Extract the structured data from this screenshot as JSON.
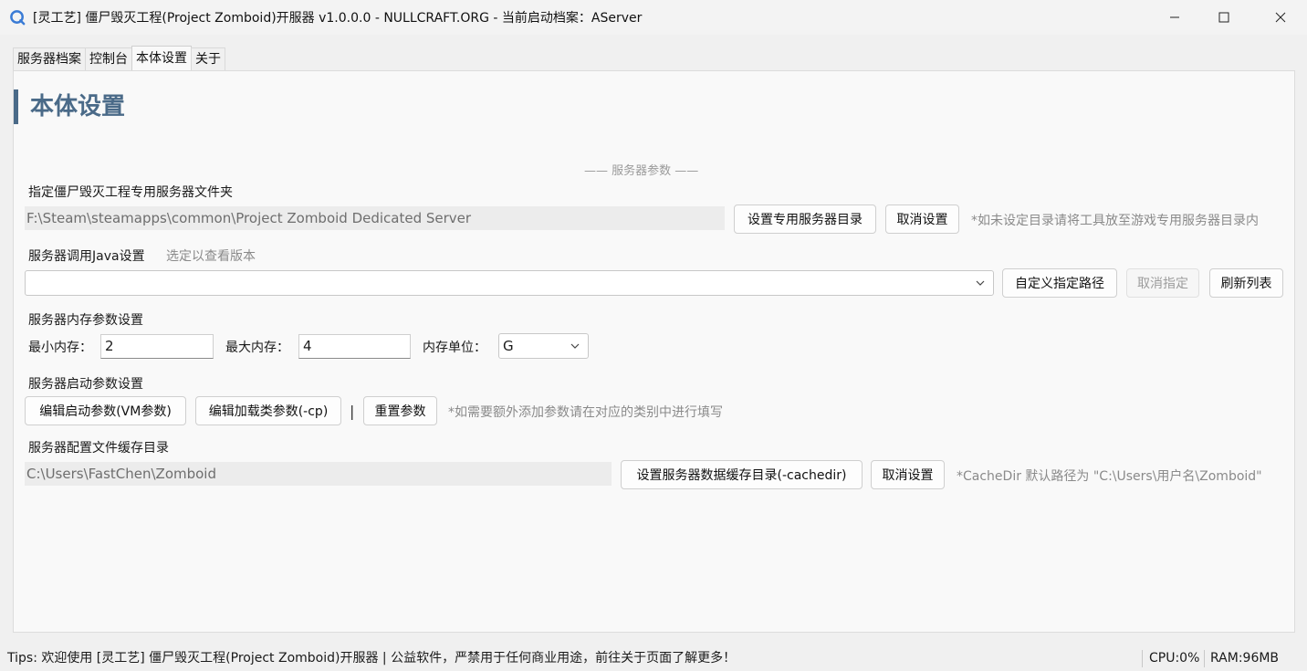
{
  "window": {
    "title": "[灵工艺] 僵尸毁灭工程(Project Zomboid)开服器 v1.0.0.0 - NULLCRAFT.ORG - 当前启动档案：AServer"
  },
  "tabs": [
    {
      "label": "服务器档案",
      "active": false
    },
    {
      "label": "控制台",
      "active": false
    },
    {
      "label": "本体设置",
      "active": true
    },
    {
      "label": "关于",
      "active": false
    }
  ],
  "page": {
    "title": "本体设置",
    "section_header": "—— 服务器参数 ——"
  },
  "server_dir": {
    "label": "指定僵尸毁灭工程专用服务器文件夹",
    "value": "F:\\Steam\\steamapps\\common\\Project Zomboid Dedicated Server",
    "set_button": "设置专用服务器目录",
    "cancel_button": "取消设置",
    "hint": "*如未设定目录请将工具放至游戏专用服务器目录内"
  },
  "java": {
    "label": "服务器调用Java设置",
    "hint": "选定以查看版本",
    "selected": "",
    "custom_button": "自定义指定路径",
    "cancel_button": "取消指定",
    "refresh_button": "刷新列表"
  },
  "memory": {
    "label": "服务器内存参数设置",
    "min_label": "最小内存：",
    "min_value": "2",
    "max_label": "最大内存：",
    "max_value": "4",
    "unit_label": "内存单位：",
    "unit_value": "G"
  },
  "launch": {
    "label": "服务器启动参数设置",
    "vm_button": "编辑启动参数(VM参数)",
    "cp_button": "编辑加载类参数(-cp)",
    "separator": "|",
    "reset_button": "重置参数",
    "hint": "*如需要额外添加参数请在对应的类别中进行填写"
  },
  "cache": {
    "label": "服务器配置文件缓存目录",
    "value": "C:\\Users\\FastChen\\Zomboid",
    "set_button": "设置服务器数据缓存目录(-cachedir)",
    "cancel_button": "取消设置",
    "hint": "*CacheDir 默认路径为 \"C:\\Users\\用户名\\Zomboid\""
  },
  "status": {
    "tips": "Tips:  欢迎使用 [灵工艺] 僵尸毁灭工程(Project Zomboid)开服器 | 公益软件，严禁用于任何商业用途，前往关于页面了解更多！",
    "cpu": "CPU:0%",
    "ram": "RAM:96MB"
  },
  "colors": {
    "accent": "#4a6a88",
    "window_bg": "#f0f0f0",
    "panel_bg": "#f9f9f9"
  }
}
